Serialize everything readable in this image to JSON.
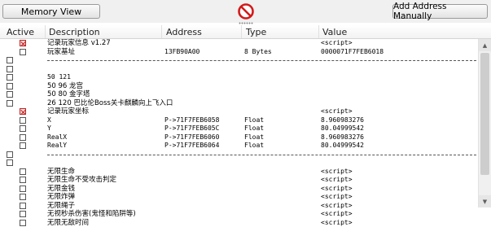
{
  "toolbar": {
    "memory_view_label": "Memory View",
    "add_address_label": "Add Address Manually"
  },
  "header": {
    "active": "Active",
    "description": "Description",
    "address": "Address",
    "type": "Type",
    "value": "Value"
  },
  "colors": {
    "active_check": "#c02020",
    "prohibit": "#d21a1a"
  },
  "rows": [
    {
      "kind": "entry",
      "active": true,
      "description": "记录玩家信息 v1.27",
      "address": "",
      "type": "",
      "value": "<script>"
    },
    {
      "kind": "entry",
      "active": false,
      "description": "玩家基址",
      "address": "13FB90A00",
      "type": "8 Bytes",
      "value": "0000071F7FEB6018"
    },
    {
      "kind": "separator",
      "active": false
    },
    {
      "kind": "entry",
      "active": false,
      "description": "",
      "address": "",
      "type": "",
      "value": ""
    },
    {
      "kind": "entry",
      "active": false,
      "description": "50 121",
      "address": "",
      "type": "",
      "value": ""
    },
    {
      "kind": "entry",
      "active": false,
      "description": "50 96  龙宫",
      "address": "",
      "type": "",
      "value": ""
    },
    {
      "kind": "entry",
      "active": false,
      "description": "50 80  金字塔",
      "address": "",
      "type": "",
      "value": ""
    },
    {
      "kind": "entry",
      "active": false,
      "description": "26 120  巴比伦Boss关卡麒麟向上飞入口",
      "address": "",
      "type": "",
      "value": ""
    },
    {
      "kind": "entry",
      "active": true,
      "description": "记录玩家坐标",
      "address": "",
      "type": "",
      "value": "<script>"
    },
    {
      "kind": "entry",
      "active": false,
      "description": "X",
      "address": "P->71F7FEB6058",
      "type": "Float",
      "value": "8.960983276"
    },
    {
      "kind": "entry",
      "active": false,
      "description": "Y",
      "address": "P->71F7FEB605C",
      "type": "Float",
      "value": "80.04999542"
    },
    {
      "kind": "entry",
      "active": false,
      "description": "RealX",
      "address": "P->71F7FEB6060",
      "type": "Float",
      "value": "8.960983276"
    },
    {
      "kind": "entry",
      "active": false,
      "description": "RealY",
      "address": "P->71F7FEB6064",
      "type": "Float",
      "value": "80.04999542"
    },
    {
      "kind": "separator",
      "active": false
    },
    {
      "kind": "entry",
      "active": false,
      "description": "",
      "address": "",
      "type": "",
      "value": ""
    },
    {
      "kind": "entry",
      "active": false,
      "description": "无限生命",
      "address": "",
      "type": "",
      "value": "<script>"
    },
    {
      "kind": "entry",
      "active": false,
      "description": "无限生命不受攻击判定",
      "address": "",
      "type": "",
      "value": "<script>"
    },
    {
      "kind": "entry",
      "active": false,
      "description": "无限金钱",
      "address": "",
      "type": "",
      "value": "<script>"
    },
    {
      "kind": "entry",
      "active": false,
      "description": "无限炸弹",
      "address": "",
      "type": "",
      "value": "<script>"
    },
    {
      "kind": "entry",
      "active": false,
      "description": "无限绳子",
      "address": "",
      "type": "",
      "value": "<script>"
    },
    {
      "kind": "entry",
      "active": false,
      "description": "无视秒杀伤害(鬼怪和陷阱等)",
      "address": "",
      "type": "",
      "value": "<script>"
    },
    {
      "kind": "entry",
      "active": false,
      "description": "无限无敌时间",
      "address": "",
      "type": "",
      "value": "<script>"
    }
  ]
}
